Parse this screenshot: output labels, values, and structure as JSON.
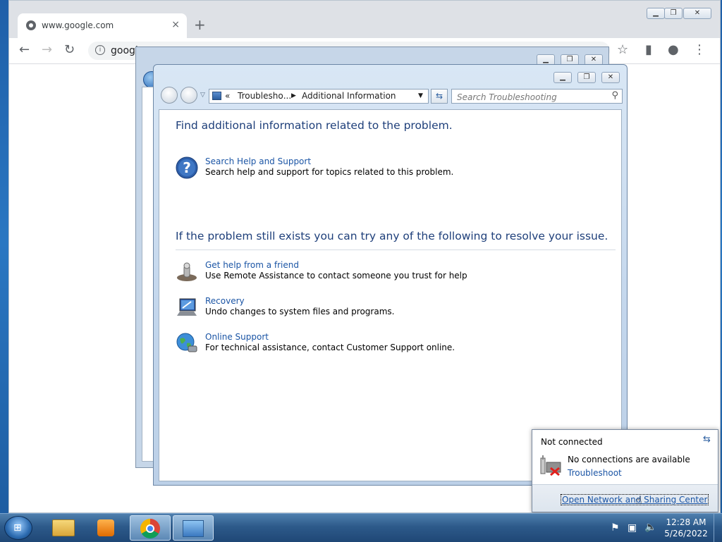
{
  "browser": {
    "tab_title": "www.google.com",
    "tab_close": "×",
    "new_tab": "+",
    "url": "googl",
    "window_controls": {
      "minimize": "▁",
      "maximize": "❐",
      "close": "✕"
    }
  },
  "window": {
    "breadcrumb": {
      "prefix": "«",
      "parent": "Troubleshо...",
      "separator": "▶",
      "current": "Additional Information"
    },
    "search_placeholder": "Search Troubleshooting",
    "controls": {
      "minimize": "▁",
      "maximize": "❐",
      "close": "✕"
    }
  },
  "content": {
    "heading1": "Find additional information related to the problem.",
    "heading2": "If the problem still exists you can try any of the following to resolve your issue.",
    "items": [
      {
        "link": "Search Help and Support",
        "desc": "Search help and support for topics related to this problem.",
        "icon": "help-icon"
      },
      {
        "link": "Get help from a friend",
        "desc": "Use Remote Assistance to contact someone you trust for help",
        "icon": "remote-assistance-icon"
      },
      {
        "link": "Recovery",
        "desc": "Undo changes to system files and programs.",
        "icon": "recovery-icon"
      },
      {
        "link": "Online Support",
        "desc": "For technical assistance, contact Customer Support online.",
        "icon": "globe-icon"
      }
    ]
  },
  "flyout": {
    "title": "Not connected",
    "status": "No connections are available",
    "troubleshoot": "Troubleshoot",
    "open_center": "Open Network and Sharing Center"
  },
  "taskbar": {
    "time": "12:28 AM",
    "date": "5/26/2022"
  },
  "colors": {
    "link": "#1b55a5",
    "heading": "#1e3f7a"
  }
}
